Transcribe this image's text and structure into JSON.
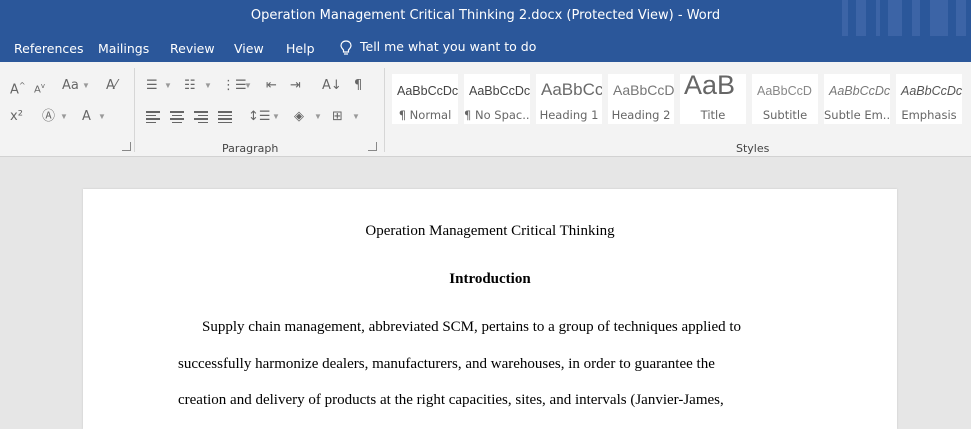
{
  "window": {
    "title": "Operation Management Critical Thinking 2.docx (Protected View)  -  Word"
  },
  "menu": {
    "items": [
      "References",
      "Mailings",
      "Review",
      "View",
      "Help"
    ],
    "tell_me": "Tell me what you want to do"
  },
  "ribbon": {
    "groups": {
      "paragraph": "Paragraph",
      "styles": "Styles"
    },
    "styles": [
      {
        "sample": "AaBbCcDc",
        "name": "¶ Normal"
      },
      {
        "sample": "AaBbCcDc",
        "name": "¶ No Spac..."
      },
      {
        "sample": "AaBbCc",
        "name": "Heading 1"
      },
      {
        "sample": "AaBbCcD",
        "name": "Heading 2"
      },
      {
        "sample": "AaB",
        "name": "Title"
      },
      {
        "sample": "AaBbCcD",
        "name": "Subtitle"
      },
      {
        "sample": "AaBbCcDc",
        "name": "Subtle Em..."
      },
      {
        "sample": "AaBbCcDc",
        "name": "Emphasis"
      }
    ]
  },
  "document": {
    "title": "Operation Management Critical Thinking",
    "heading": "Introduction",
    "lines": [
      "Supply chain management, abbreviated SCM, pertains to a group of techniques applied to",
      "successfully harmonize dealers, manufacturers, and warehouses, in order to guarantee the",
      "creation and delivery of products at the right capacities, sites, and intervals (Janvier-James,"
    ]
  },
  "colors": {
    "accent": "#2b579a",
    "ribbon": "#f3f3f3",
    "canvas": "#e6e6e6"
  }
}
